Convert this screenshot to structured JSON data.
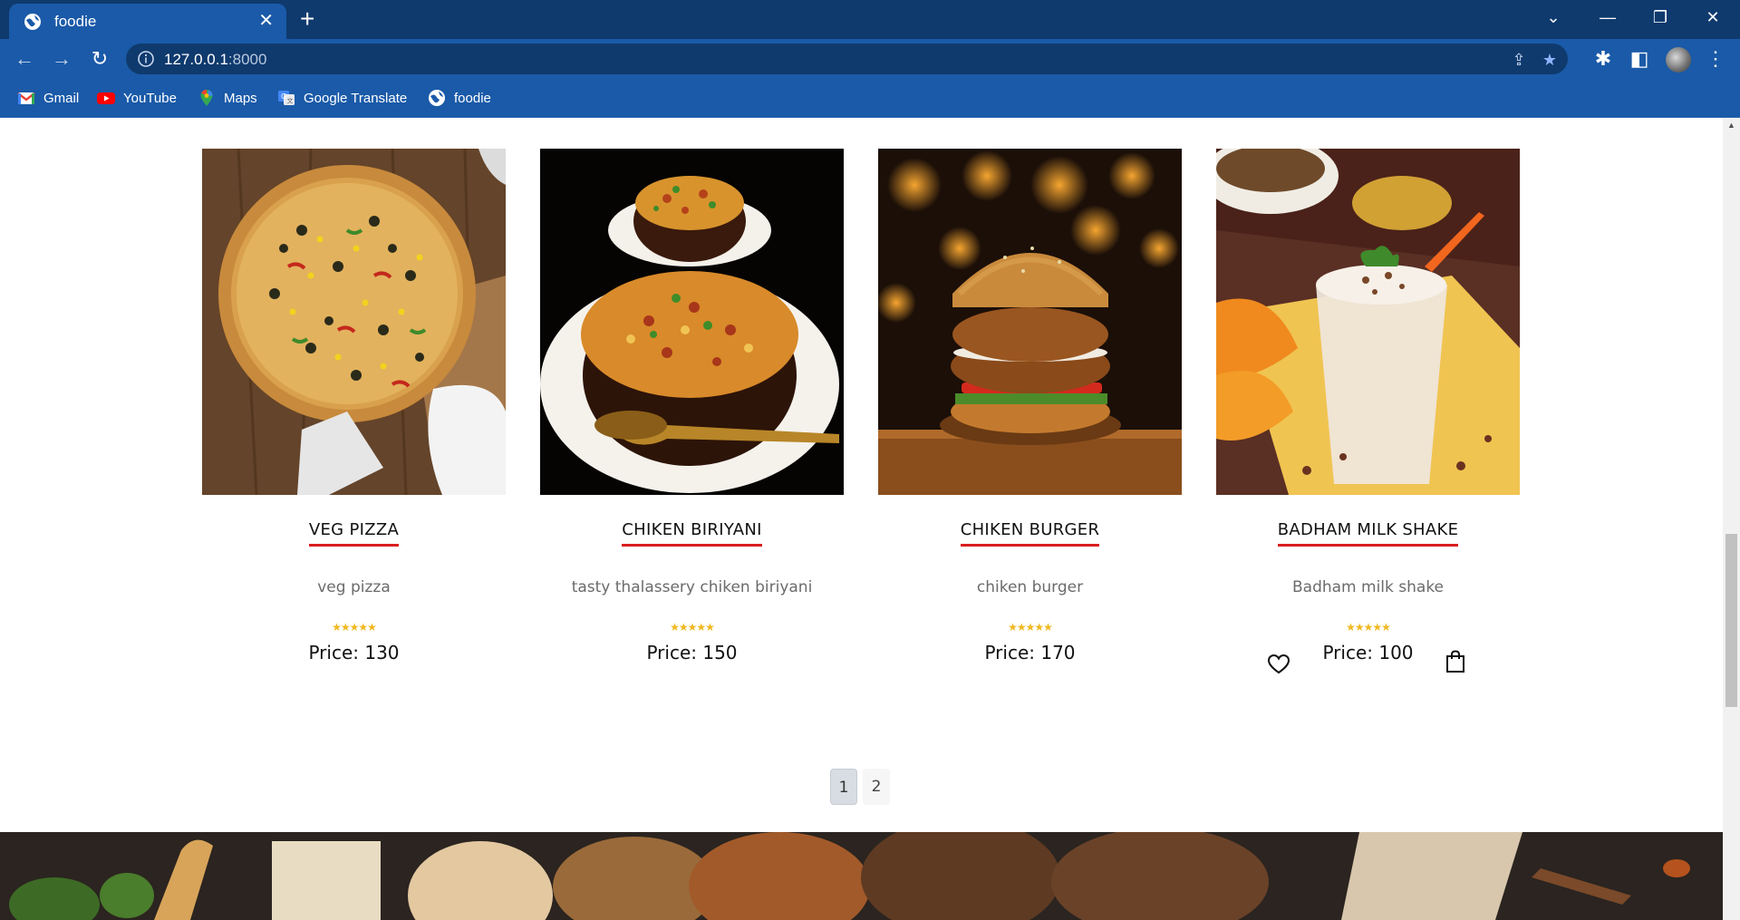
{
  "browser": {
    "tab_title": "foodie",
    "url_host": "127.0.0.1",
    "url_port": ":8000",
    "bookmarks": [
      {
        "label": "Gmail",
        "icon": "gmail-icon"
      },
      {
        "label": "YouTube",
        "icon": "youtube-icon"
      },
      {
        "label": "Maps",
        "icon": "maps-icon"
      },
      {
        "label": "Google Translate",
        "icon": "translate-icon"
      },
      {
        "label": "foodie",
        "icon": "globe-icon"
      }
    ]
  },
  "products": [
    {
      "title": "VEG PIZZA",
      "description": "veg pizza",
      "rating_stars": "★★★★★",
      "price": "Price: 130",
      "image": "pizza"
    },
    {
      "title": "CHIKEN BIRIYANI",
      "description": "tasty thalassery chiken biriyani",
      "rating_stars": "★★★★★",
      "price": "Price: 150",
      "image": "biriyani"
    },
    {
      "title": "CHIKEN BURGER",
      "description": "chiken burger",
      "rating_stars": "★★★★★",
      "price": "Price: 170",
      "image": "burger"
    },
    {
      "title": "BADHAM MILK SHAKE",
      "description": "Badham milk shake",
      "rating_stars": "★★★★★",
      "price": "Price: 100",
      "image": "milkshake"
    }
  ],
  "pagination": {
    "pages": [
      "1",
      "2"
    ],
    "current": "1"
  },
  "colors": {
    "accent_underline": "#d91e1e",
    "stars": "#f0b921",
    "chrome_dark": "#0f3a6e",
    "chrome": "#1a5aa8"
  }
}
